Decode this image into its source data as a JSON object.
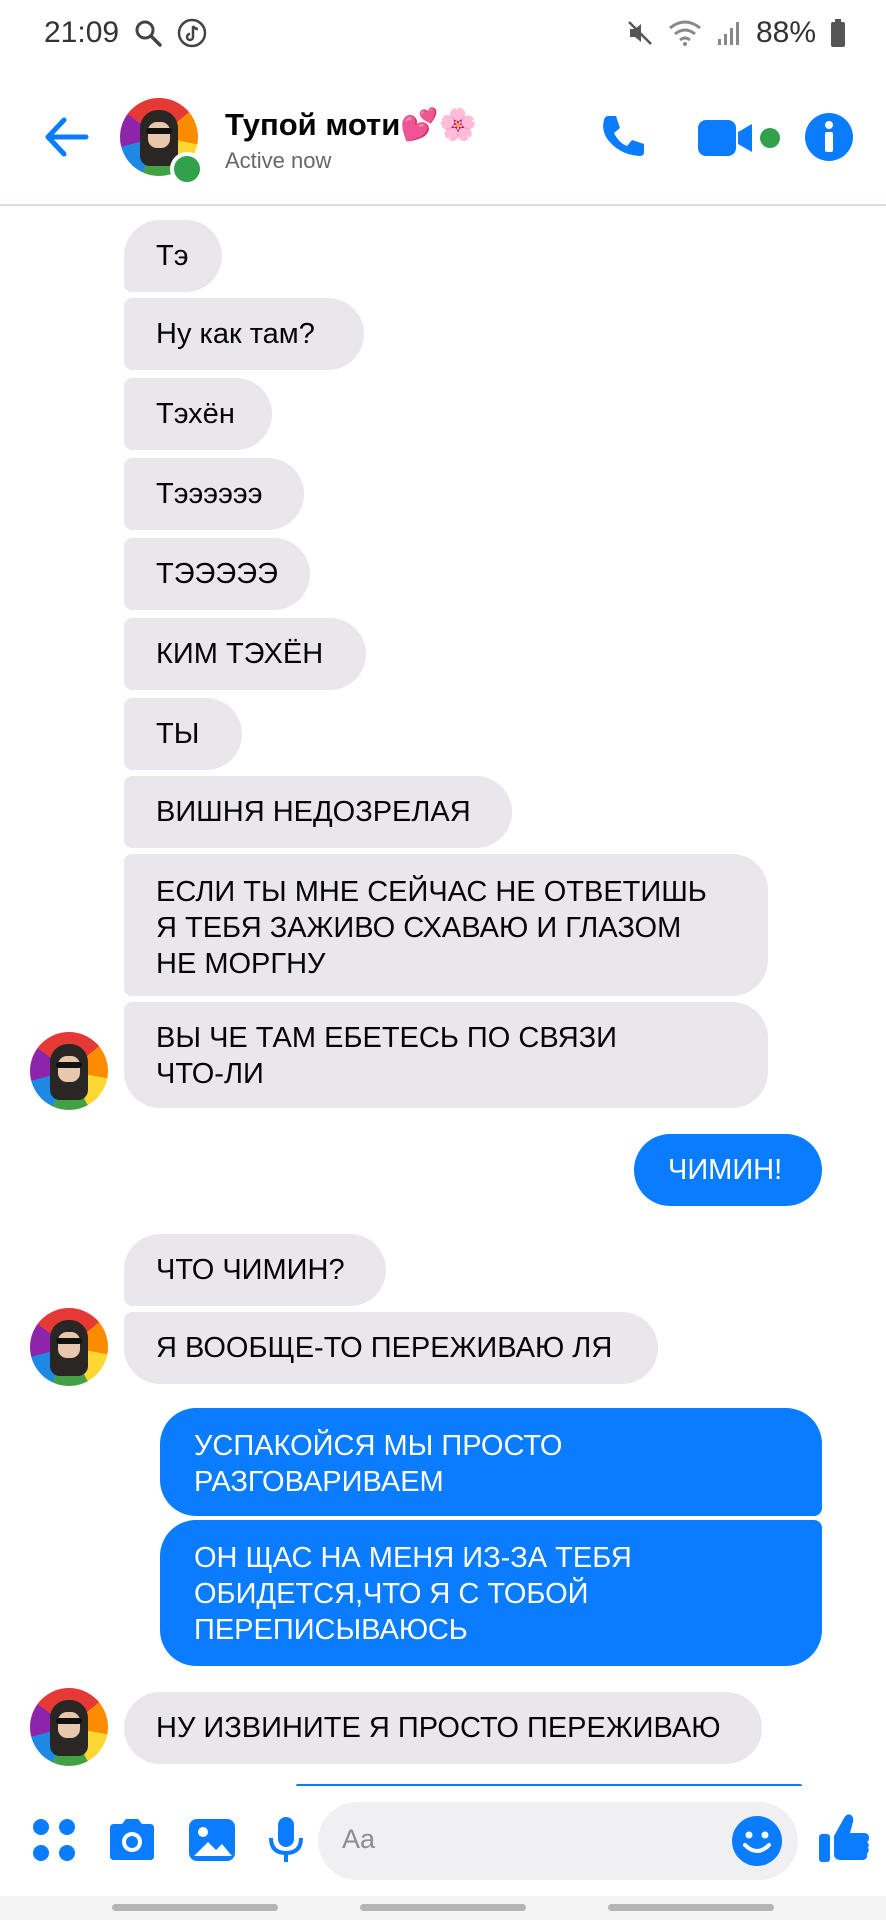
{
  "status_bar": {
    "time": "21:09",
    "battery": "88%",
    "icons": [
      "search-icon",
      "tiktok-icon",
      "mute-icon",
      "wifi-icon",
      "signal-icon",
      "battery-icon"
    ]
  },
  "header": {
    "contact_name": "Тупой моти💕🌸",
    "contact_status": "Active now",
    "accent_color": "#0a7cff",
    "online_color": "#31a24c",
    "icons": [
      "back-arrow-icon",
      "phone-icon",
      "video-camera-icon",
      "info-icon"
    ]
  },
  "messages": [
    {
      "dir": "in",
      "text": "Тэ"
    },
    {
      "dir": "in",
      "text": "Ну как там?"
    },
    {
      "dir": "in",
      "text": "Тэхён"
    },
    {
      "dir": "in",
      "text": "Тээээээ"
    },
    {
      "dir": "in",
      "text": "ТЭЭЭЭЭ"
    },
    {
      "dir": "in",
      "text": "КИМ ТЭХЁН"
    },
    {
      "dir": "in",
      "text": "ТЫ"
    },
    {
      "dir": "in",
      "text": "ВИШНЯ НЕДОЗРЕЛАЯ"
    },
    {
      "dir": "in",
      "text": "ЕСЛИ ТЫ МНЕ СЕЙЧАС НЕ ОТВЕТИШЬ Я ТЕБЯ ЗАЖИВО СХАВАЮ И ГЛАЗОМ НЕ МОРГНУ"
    },
    {
      "dir": "in",
      "text": "ВЫ ЧЕ ТАМ ЕБЕТЕСЬ ПО СВЯЗИ ЧТО-ЛИ"
    },
    {
      "dir": "out",
      "text": "ЧИМИН!"
    },
    {
      "dir": "in",
      "text": "ЧТО ЧИМИН?"
    },
    {
      "dir": "in",
      "text": "Я ВООБЩЕ-ТО ПЕРЕЖИВАЮ ЛЯ"
    },
    {
      "dir": "out",
      "text": "УСПАКОЙСЯ МЫ ПРОСТО РАЗГОВАРИВАЕМ"
    },
    {
      "dir": "out",
      "text": "ОН ЩАС НА МЕНЯ ИЗ-ЗА ТЕБЯ ОБИДЕТСЯ,ЧТО Я С ТОБОЙ ПЕРЕПИСЫВАЮСЬ"
    },
    {
      "dir": "in",
      "text": "НУ ИЗВИНИТЕ Я ПРОСТО ПЕРЕЖИВАЮ"
    }
  ],
  "composer": {
    "placeholder": "Aa",
    "icons": [
      "apps-icon",
      "camera-icon",
      "gallery-icon",
      "microphone-icon",
      "emoji-icon",
      "thumbs-up-icon"
    ]
  }
}
